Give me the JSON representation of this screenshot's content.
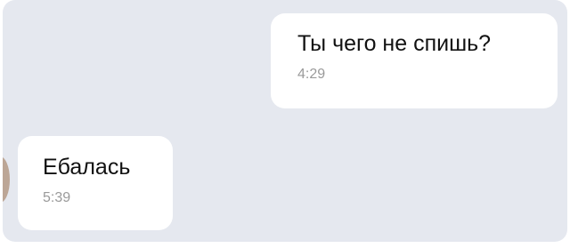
{
  "messages": [
    {
      "direction": "outgoing",
      "text": "Ты чего не спишь?",
      "time": "4:29"
    },
    {
      "direction": "incoming",
      "text": "Ебалась",
      "time": "5:39"
    }
  ],
  "colors": {
    "chat_background": "#e5e8ef",
    "bubble_background": "#ffffff",
    "text": "#111111",
    "timestamp": "#9a9a9a"
  }
}
